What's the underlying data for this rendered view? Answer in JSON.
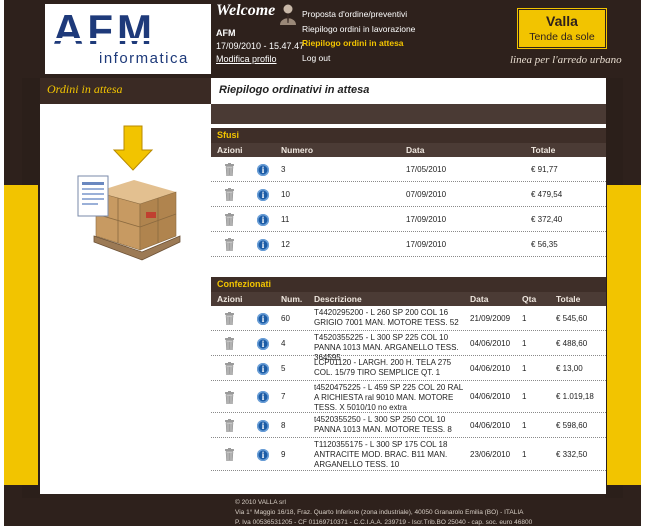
{
  "header": {
    "logo_text": "AFM",
    "logo_sub": "informatica",
    "welcome": "Welcome",
    "user_name": "AFM",
    "user_datetime": "17/09/2010 - 15.47.47",
    "profile_link": "Modifica profilo",
    "nav": [
      "Proposta d'ordine/preventivi",
      "Riepilogo ordini in lavorazione",
      "Riepilogo ordini in attesa",
      "Log out"
    ],
    "nav_active_index": 2,
    "brand_name": "Valla",
    "brand_sub": "Tende da sole",
    "tagline": "linea per l'arredo urbano"
  },
  "page": {
    "side_title": "Ordini in attesa",
    "main_title": "Riepilogo ordinativi in attesa"
  },
  "sfusi": {
    "title": "Sfusi",
    "columns": [
      "Azioni",
      "Numero",
      "Data",
      "Totale"
    ],
    "rows": [
      {
        "numero": "3",
        "data": "17/05/2010",
        "totale": "€ 91,77"
      },
      {
        "numero": "10",
        "data": "07/09/2010",
        "totale": "€ 479,54"
      },
      {
        "numero": "11",
        "data": "17/09/2010",
        "totale": "€ 372,40"
      },
      {
        "numero": "12",
        "data": "17/09/2010",
        "totale": "€ 56,35"
      }
    ]
  },
  "confezionati": {
    "title": "Confezionati",
    "columns": [
      "Azioni",
      "Num.",
      "Descrizione",
      "Data",
      "Qta",
      "Totale"
    ],
    "rows": [
      {
        "num": "60",
        "descrizione": "T4420295200 - L 260 SP 200 COL 16 GRIGIO 7001 MAN. MOTORE TESS. 52",
        "data": "21/09/2009",
        "qta": "1",
        "totale": "€ 545,60"
      },
      {
        "num": "4",
        "descrizione": "T4520355225 - L 300 SP 225 COL 10 PANNA 1013 MAN. ARGANELLO TESS. 364595",
        "data": "04/06/2010",
        "qta": "1",
        "totale": "€ 488,60"
      },
      {
        "num": "5",
        "descrizione": "LCP01120 - LARGH. 200 H. TELA 275 COL. 15/79 TIRO SEMPLICE QT. 1",
        "data": "04/06/2010",
        "qta": "1",
        "totale": "€ 13,00"
      },
      {
        "num": "7",
        "descrizione": "t4520475225 - L 459 SP 225 COL 20 RAL A RICHIESTA ral 9010 MAN. MOTORE TESS. X 5010/10 no extra",
        "data": "04/06/2010",
        "qta": "1",
        "totale": "€ 1.019,18"
      },
      {
        "num": "8",
        "descrizione": "t4520355250 - L 300 SP 250 COL 10 PANNA 1013 MAN. MOTORE TESS. 8",
        "data": "04/06/2010",
        "qta": "1",
        "totale": "€ 598,60"
      },
      {
        "num": "9",
        "descrizione": "T1120355175 - L 300 SP 175 COL 18 ANTRACITE MOD. BRAC. B11 MAN. ARGANELLO TESS. 10",
        "data": "23/06/2010",
        "qta": "1",
        "totale": "€ 332,50"
      }
    ]
  },
  "footer": {
    "line1": "© 2010 VALLA srl",
    "line2": "Via 1° Maggio 16/18, Fraz. Quarto Inferiore (zona industriale), 40050 Granarolo Emilia (BO) - ITALIA",
    "line3": "P. Iva 00536531205 - CF 01169710371 - C.C.I.A.A. 239719 - Iscr.Trib.BO 25040 - cap. soc. euro 46800"
  },
  "colors": {
    "accent": "#f2c400",
    "dark": "#2e211c",
    "logo_blue": "#1e3a7a",
    "info_blue": "#1c5ca6"
  }
}
